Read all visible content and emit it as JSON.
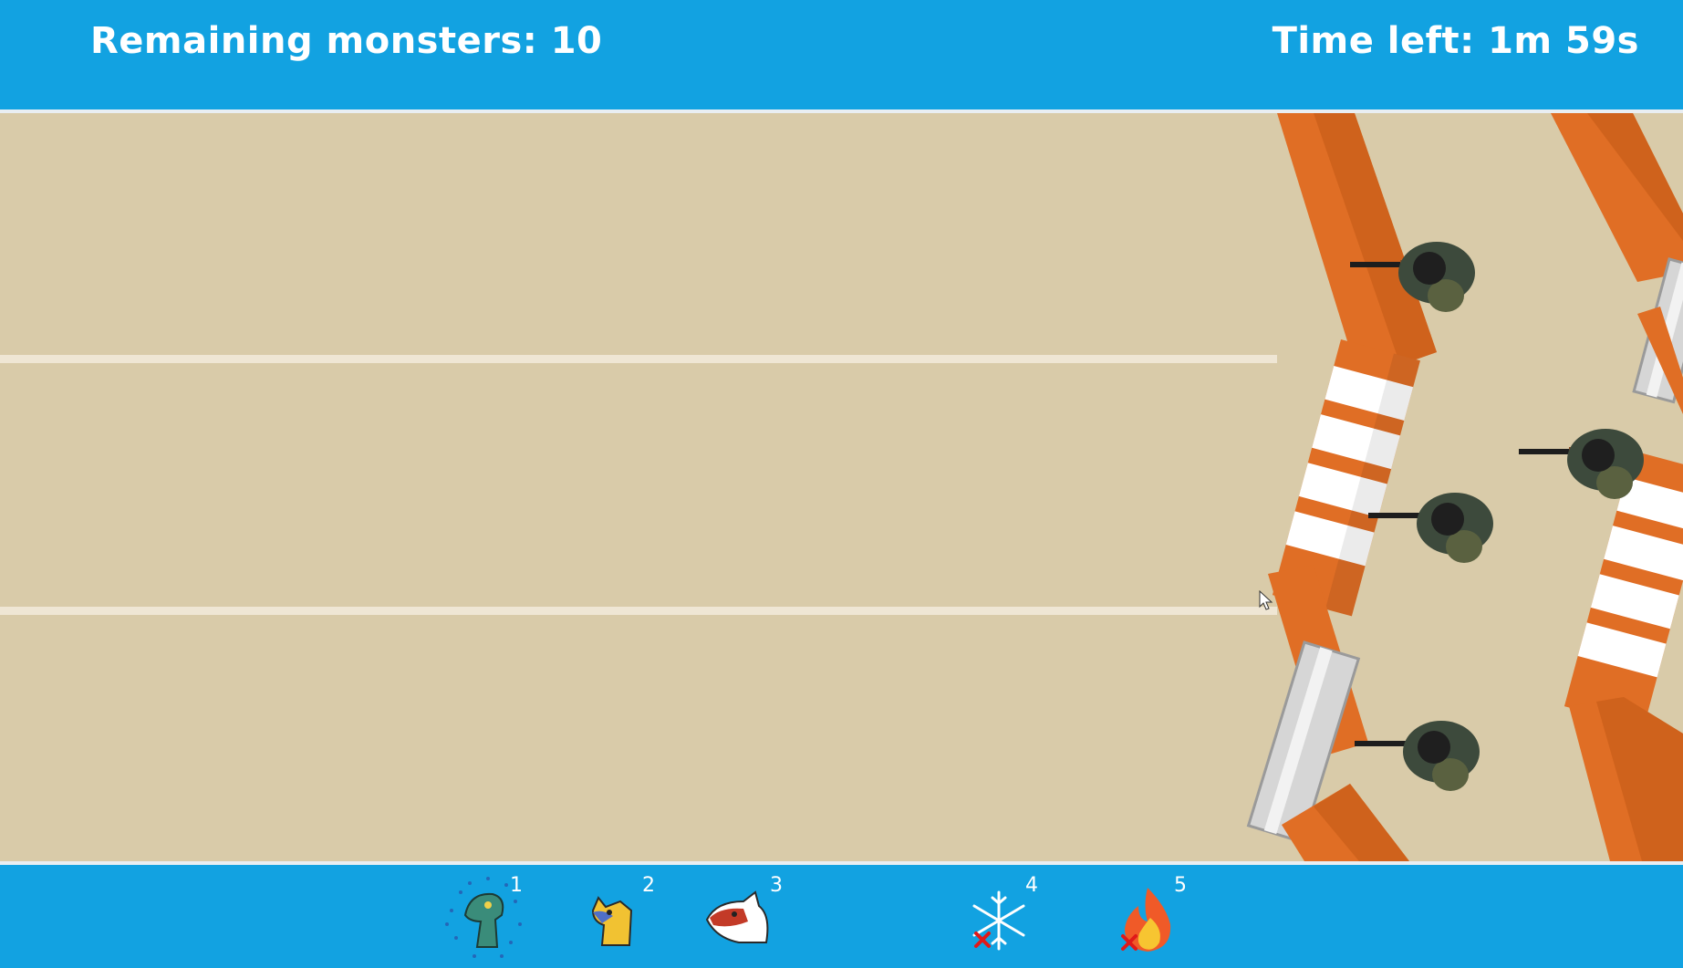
{
  "hud": {
    "remaining_monsters": "Remaining monsters: 10",
    "time_left": "Time left: 1m 59s"
  },
  "hotbar": {
    "slots": [
      {
        "key": "1",
        "icon": "raptor-monster-icon",
        "selected": true
      },
      {
        "key": "2",
        "icon": "yellow-dragon-monster-icon"
      },
      {
        "key": "3",
        "icon": "red-dragon-monster-icon"
      },
      {
        "key": "4",
        "icon": "freeze-spell-icon",
        "disabled": true
      },
      {
        "key": "5",
        "icon": "fire-spell-icon",
        "disabled": true
      }
    ]
  },
  "field": {
    "lanes": 3,
    "soldiers": 4
  },
  "colors": {
    "hud_blue": "#12a2e1",
    "sand": "#d9cba9",
    "barricade_orange": "#e06e25",
    "stripe_white": "#ffffff"
  }
}
